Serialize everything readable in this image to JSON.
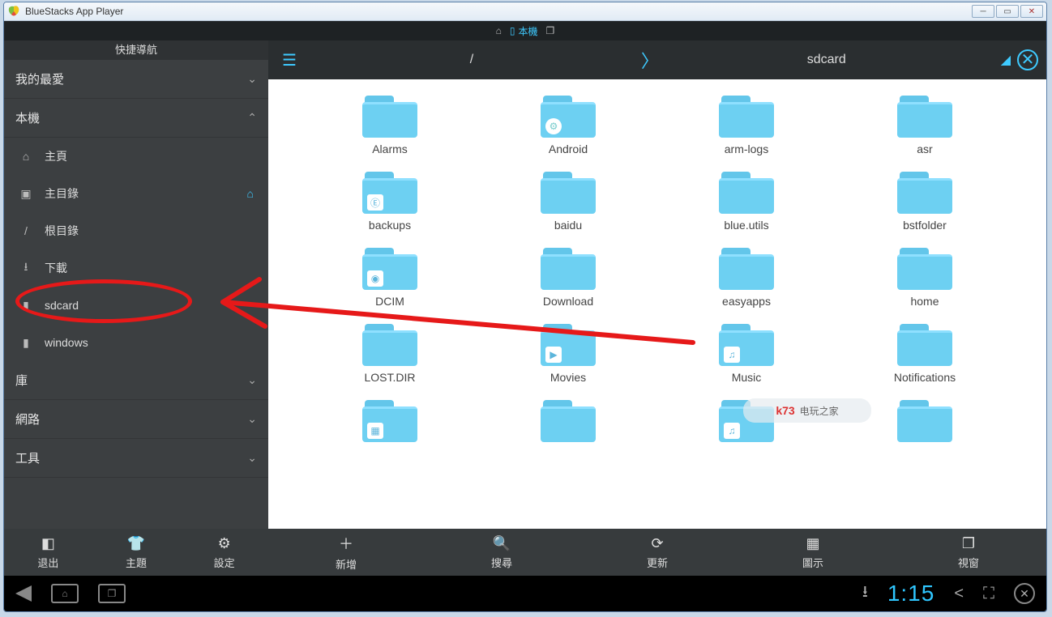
{
  "window": {
    "title": "BlueStacks App Player"
  },
  "top_tabs": {
    "active": "本機"
  },
  "sidebar": {
    "title": "快捷導航",
    "sections": {
      "favorites": {
        "label": "我的最愛"
      },
      "local": {
        "label": "本機"
      },
      "library": {
        "label": "庫"
      },
      "network": {
        "label": "網路"
      },
      "tools": {
        "label": "工具"
      }
    },
    "local_items": [
      {
        "label": "主頁",
        "icon": "home"
      },
      {
        "label": "主目錄",
        "icon": "camera",
        "trail": "home"
      },
      {
        "label": "根目錄",
        "icon": "slash"
      },
      {
        "label": "下載",
        "icon": "download"
      },
      {
        "label": "sdcard",
        "icon": "sdcard"
      },
      {
        "label": "windows",
        "icon": "sdcard"
      }
    ]
  },
  "breadcrumb": {
    "root": "/",
    "current": "sdcard"
  },
  "folders": [
    {
      "name": "Alarms",
      "badge": ""
    },
    {
      "name": "Android",
      "badge": "gear"
    },
    {
      "name": "arm-logs",
      "badge": ""
    },
    {
      "name": "asr",
      "badge": ""
    },
    {
      "name": "backups",
      "badge": "es"
    },
    {
      "name": "baidu",
      "badge": ""
    },
    {
      "name": "blue.utils",
      "badge": ""
    },
    {
      "name": "bstfolder",
      "badge": ""
    },
    {
      "name": "DCIM",
      "badge": "camera"
    },
    {
      "name": "Download",
      "badge": ""
    },
    {
      "name": "easyapps",
      "badge": ""
    },
    {
      "name": "home",
      "badge": ""
    },
    {
      "name": "LOST.DIR",
      "badge": ""
    },
    {
      "name": "Movies",
      "badge": "play"
    },
    {
      "name": "Music",
      "badge": "music"
    },
    {
      "name": "Notifications",
      "badge": ""
    },
    {
      "name": "",
      "badge": "image"
    },
    {
      "name": "",
      "badge": ""
    },
    {
      "name": "",
      "badge": "music"
    },
    {
      "name": "",
      "badge": ""
    }
  ],
  "toolbar_left": [
    {
      "label": "退出",
      "icon": "exit"
    },
    {
      "label": "主題",
      "icon": "shirt"
    },
    {
      "label": "設定",
      "icon": "gear"
    }
  ],
  "toolbar_right": [
    {
      "label": "新增",
      "icon": "plus"
    },
    {
      "label": "搜尋",
      "icon": "search"
    },
    {
      "label": "更新",
      "icon": "refresh"
    },
    {
      "label": "圖示",
      "icon": "grid"
    },
    {
      "label": "視窗",
      "icon": "windows"
    }
  ],
  "android": {
    "time": "1:15"
  },
  "watermark": {
    "brand": "k73",
    "text": "电玩之家"
  }
}
